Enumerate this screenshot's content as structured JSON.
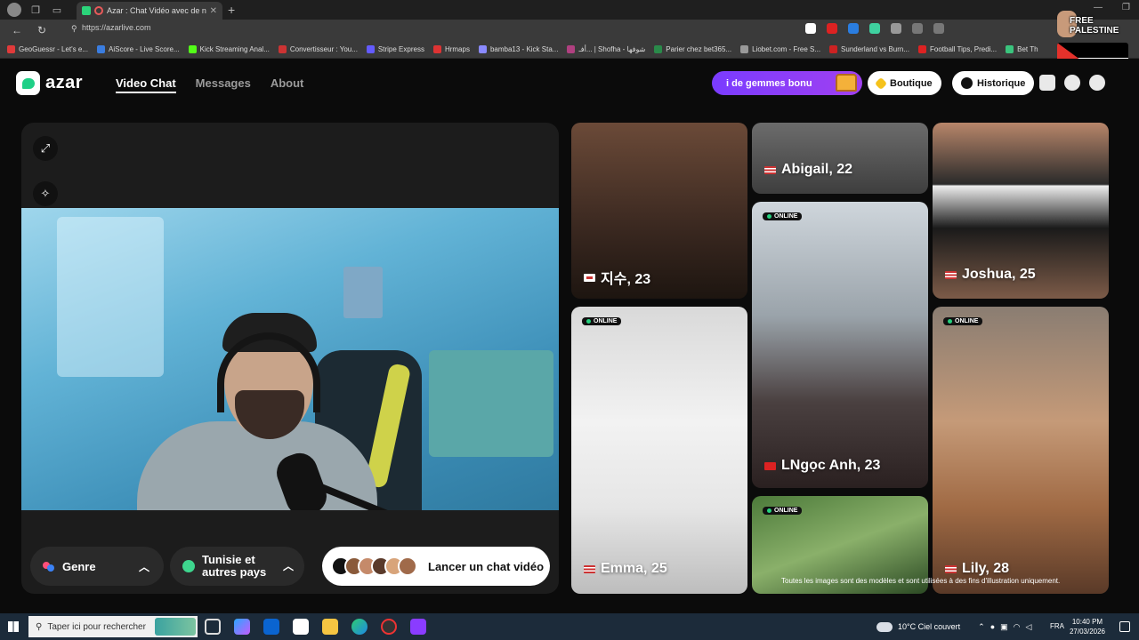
{
  "browser": {
    "tab_title": "Azar : Chat Vidéo avec de n",
    "url": "https://azarlive.com",
    "bookmarks": [
      {
        "label": "GeoGuessr - Let's e...",
        "color": "#e03a3a"
      },
      {
        "label": "AiScore - Live Score...",
        "color": "#3a7de0"
      },
      {
        "label": "Kick Streaming Anal...",
        "color": "#53fc18"
      },
      {
        "label": "Convertisseur : You...",
        "color": "#c33"
      },
      {
        "label": "Stripe Express",
        "color": "#635bff"
      },
      {
        "label": "Hrmaps",
        "color": "#d33"
      },
      {
        "label": "bamba13 - Kick Sta...",
        "color": "#8a8aff"
      },
      {
        "label": "أفـ... | Shofha - شوفها",
        "color": "#b04080"
      },
      {
        "label": "Parier chez bet365...",
        "color": "#2a8a4a"
      },
      {
        "label": "Liobet.com - Free S...",
        "color": "#999"
      },
      {
        "label": "Sunderland vs Burn...",
        "color": "#c22"
      },
      {
        "label": "Football Tips, Predi...",
        "color": "#d22"
      },
      {
        "label": "Bet Th",
        "color": "#3ac47d"
      }
    ],
    "overlay_text": "FREE PALESTINE"
  },
  "header": {
    "logo_text": "azar",
    "nav": [
      {
        "label": "Video Chat",
        "active": true
      },
      {
        "label": "Messages",
        "active": false
      },
      {
        "label": "About",
        "active": false
      }
    ],
    "gems_button": "i de gemmes bonu",
    "shop_button": "Boutique",
    "history_button": "Historique"
  },
  "video_panel": {
    "gender_filter": "Genre",
    "region_filter": "Tunisie et autres pays",
    "launch_button": "Lancer un chat vidéo"
  },
  "profiles": [
    {
      "name": "지수, 23",
      "flag": "KR",
      "online": false
    },
    {
      "name": "Abigail, 22",
      "flag": "US",
      "online": false
    },
    {
      "name": "Joshua, 25",
      "flag": "US",
      "online": false
    },
    {
      "name": "LNgọc Anh, 23",
      "flag": "VN",
      "online": true
    },
    {
      "name": "Emma, 25",
      "flag": "US",
      "online": true
    },
    {
      "name": "Lily, 28",
      "flag": "US",
      "online": true
    },
    {
      "name": "",
      "flag": "",
      "online": true
    }
  ],
  "online_label": "ONLINE",
  "disclaimer": "Toutes les images sont des modèles et sont utilisées à des fins d'illustration uniquement.",
  "taskbar": {
    "search_placeholder": "Taper ici pour rechercher",
    "weather": "10°C  Ciel couvert",
    "language": "FRA",
    "time": "10:40 PM",
    "date": "27/03/2026"
  }
}
